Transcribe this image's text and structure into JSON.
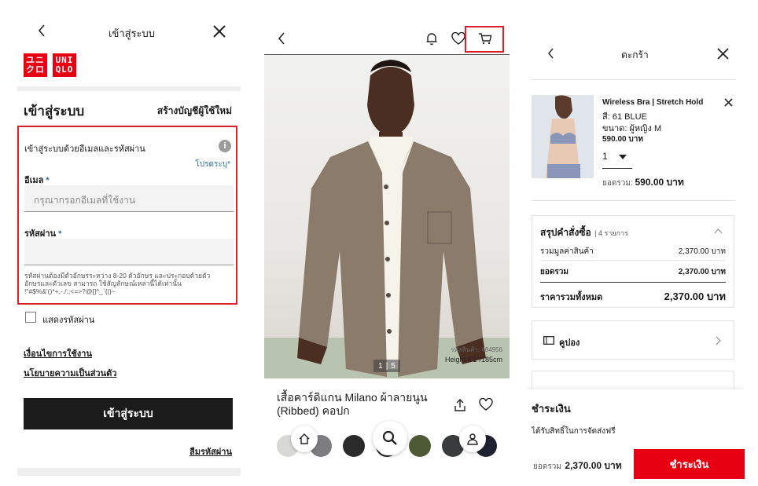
{
  "login": {
    "header_title": "เข้าสู่ระบบ",
    "logo_top": "ユニ",
    "logo_bottom": "クロ",
    "logo2_top": "UNI",
    "logo2_bottom": "QLO",
    "section_title": "เข้าสู่ระบบ",
    "create_account": "สร้างบัญชีผู้ใช้ใหม่",
    "form_title": "เข้าสู่ระบบด้วยอีเมลและรหัสผ่าน",
    "required_note": "โปรดระบุ*",
    "email_label": "อีเมล",
    "email_placeholder": "กรุณากรอกอีเมลที่ใช้งาน",
    "password_label": "รหัสผ่าน",
    "required_mark": "*",
    "password_hint_1": "รหัสผ่านต้องมีตัวอักษรระหว่าง 8-20 ตัวอักษร และประกอบด้วยตัว",
    "password_hint_2": "อักษรและตัวเลข สามารถ ใช้สัญลักษณ์เหล่านี้ได้เท่านั้น",
    "password_hint_3": "!\"#$%&'()*+,-./:;<=>?@[]^_`{|}~",
    "show_password": "แสดงรหัสผ่าน",
    "terms_link": "เงื่อนไขการใช้งาน",
    "privacy_link": "นโยบายความเป็นส่วนตัว",
    "login_button": "เข้าสู่ระบบ",
    "forgot_password": "ลืมรหัสผ่าน"
  },
  "product": {
    "model_code": "รหัสสินค้า: 484956",
    "model_height": "Height:6'1\"/185cm",
    "image_counter_current": "1",
    "image_counter_total": "5",
    "name_line1": "เสื้อคาร์ดิแกน Milano ผ้าลายนูน",
    "name_line2": "(Ribbed) คอปก",
    "swatch_colors": [
      "#d8d8d6",
      "#7d7d7f",
      "#2a2a2a",
      "#ffffff",
      "#4d5a35",
      "#3a3b3c",
      "#1f2230"
    ]
  },
  "cart": {
    "header_title": "ตะกร้า",
    "item_name": "Wireless Bra | Stretch Hold",
    "item_color": "สี: 61 BLUE",
    "item_size": "ขนาด: ผู้หญิง M",
    "item_price": "590.00 บาท",
    "item_qty": "1",
    "item_subtotal_label": "ยอดรวม:",
    "item_subtotal_value": "590.00 บาท",
    "summary_title": "สรุปคำสั่งซื้อ",
    "summary_count": "| 4 รายการ",
    "merch_label": "รวมมูลค่าสินค้า",
    "merch_value": "2,370.00 บาท",
    "subtotal_label": "ยอดรวม",
    "subtotal_value": "2,370.00 บาท",
    "total_label": "ราคารวมทั้งหมด",
    "total_value": "2,370.00 บาท",
    "coupon_label": "คูปอง",
    "payment_title": "ชำระเงิน",
    "payment_note": "ได้รับสิทธิ์ในการจัดส่งฟรี",
    "footer_total_label": "ยอดรวม",
    "footer_total_value": "2,370.00 บาท",
    "pay_button": "ชำระเงิน"
  },
  "colors": {
    "brand_red": "#e60012",
    "highlight_red": "#d9242b"
  }
}
